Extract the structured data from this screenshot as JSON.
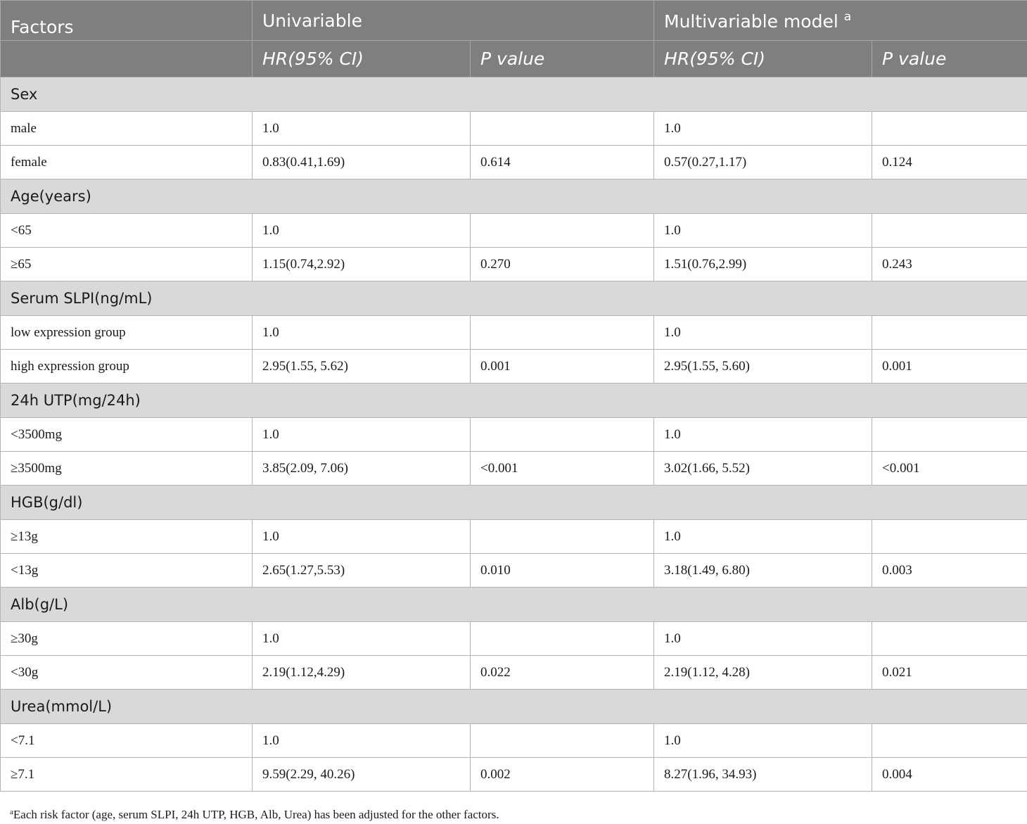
{
  "header": {
    "factors": "Factors",
    "univariable": "Univariable",
    "multivariable": "Multivariable model",
    "multivariable_sup": "a",
    "hr": "HR",
    "ci": "(95% CI)",
    "p_value": "P value"
  },
  "groups": [
    {
      "title": "Sex",
      "rows": [
        {
          "label": "male",
          "uni_hr": "1.0",
          "uni_p": "",
          "multi_hr": "1.0",
          "multi_p": ""
        },
        {
          "label": "female",
          "uni_hr": "0.83(0.41,1.69)",
          "uni_p": "0.614",
          "multi_hr": "0.57(0.27,1.17)",
          "multi_p": "0.124"
        }
      ]
    },
    {
      "title": "Age(years)",
      "rows": [
        {
          "label": "<65",
          "uni_hr": "1.0",
          "uni_p": "",
          "multi_hr": "1.0",
          "multi_p": ""
        },
        {
          "label": "≥65",
          "uni_hr": "1.15(0.74,2.92)",
          "uni_p": "0.270",
          "multi_hr": "1.51(0.76,2.99)",
          "multi_p": "0.243"
        }
      ]
    },
    {
      "title": "Serum SLPI(ng/mL)",
      "rows": [
        {
          "label": "low expression group",
          "uni_hr": "1.0",
          "uni_p": "",
          "multi_hr": "1.0",
          "multi_p": ""
        },
        {
          "label": "high expression group",
          "uni_hr": "2.95(1.55, 5.62)",
          "uni_p": "0.001",
          "multi_hr": "2.95(1.55, 5.60)",
          "multi_p": "0.001"
        }
      ]
    },
    {
      "title": "24h UTP(mg/24h)",
      "rows": [
        {
          "label": "<3500mg",
          "uni_hr": "1.0",
          "uni_p": "",
          "multi_hr": "1.0",
          "multi_p": ""
        },
        {
          "label": "≥3500mg",
          "uni_hr": "3.85(2.09, 7.06)",
          "uni_p": "<0.001",
          "multi_hr": "3.02(1.66, 5.52)",
          "multi_p": "<0.001"
        }
      ]
    },
    {
      "title": "HGB(g/dl)",
      "rows": [
        {
          "label": "≥13g",
          "uni_hr": "1.0",
          "uni_p": "",
          "multi_hr": "1.0",
          "multi_p": ""
        },
        {
          "label": "<13g",
          "uni_hr": "2.65(1.27,5.53)",
          "uni_p": "0.010",
          "multi_hr": "3.18(1.49, 6.80)",
          "multi_p": "0.003"
        }
      ]
    },
    {
      "title": "Alb(g/L)",
      "rows": [
        {
          "label": "≥30g",
          "uni_hr": "1.0",
          "uni_p": "",
          "multi_hr": "1.0",
          "multi_p": ""
        },
        {
          "label": "<30g",
          "uni_hr": "2.19(1.12,4.29)",
          "uni_p": "0.022",
          "multi_hr": "2.19(1.12, 4.28)",
          "multi_p": "0.021"
        }
      ]
    },
    {
      "title": "Urea(mmol/L)",
      "rows": [
        {
          "label": "<7.1",
          "uni_hr": "1.0",
          "uni_p": "",
          "multi_hr": "1.0",
          "multi_p": ""
        },
        {
          "label": "≥7.1",
          "uni_hr": "9.59(2.29, 40.26)",
          "uni_p": "0.002",
          "multi_hr": "8.27(1.96, 34.93)",
          "multi_p": "0.004"
        }
      ]
    }
  ],
  "footnote": {
    "marker": "a",
    "text": "Each risk factor (age, serum SLPI, 24h UTP, HGB, Alb, Urea) has been adjusted for the other factors."
  }
}
